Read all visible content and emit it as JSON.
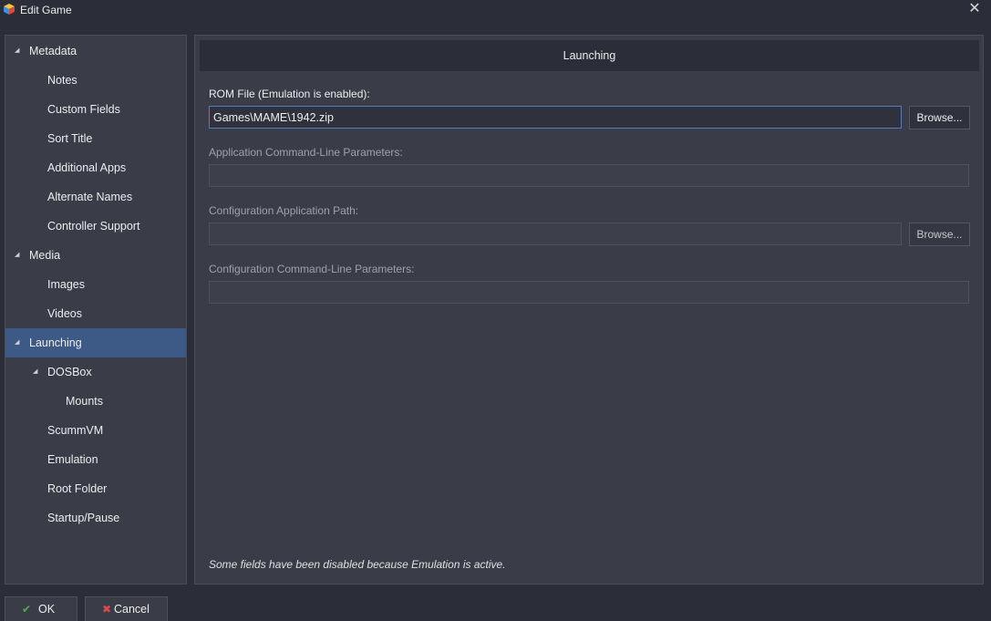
{
  "window": {
    "title": "Edit Game",
    "close_icon": "close-icon",
    "app_icon": "launchbox-cube-icon"
  },
  "sidebar": {
    "items": [
      {
        "label": "Metadata",
        "level": 0,
        "expanded": true
      },
      {
        "label": "Notes",
        "level": 1
      },
      {
        "label": "Custom Fields",
        "level": 1
      },
      {
        "label": "Sort Title",
        "level": 1
      },
      {
        "label": "Additional Apps",
        "level": 1
      },
      {
        "label": "Alternate Names",
        "level": 1
      },
      {
        "label": "Controller Support",
        "level": 1
      },
      {
        "label": "Media",
        "level": 0,
        "expanded": true
      },
      {
        "label": "Images",
        "level": 1
      },
      {
        "label": "Videos",
        "level": 1
      },
      {
        "label": "Launching",
        "level": 0,
        "expanded": true,
        "selected": true
      },
      {
        "label": "DOSBox",
        "level": 1,
        "expanded": true
      },
      {
        "label": "Mounts",
        "level": 2
      },
      {
        "label": "ScummVM",
        "level": 1
      },
      {
        "label": "Emulation",
        "level": 1
      },
      {
        "label": "Root Folder",
        "level": 1
      },
      {
        "label": "Startup/Pause",
        "level": 1
      }
    ]
  },
  "main": {
    "header": "Launching",
    "rom_file": {
      "label": "ROM File (Emulation is enabled):",
      "value": "Games\\MAME\\1942.zip",
      "browse_label": "Browse..."
    },
    "app_params": {
      "label": "Application Command-Line Parameters:",
      "value": ""
    },
    "config_path": {
      "label": "Configuration Application Path:",
      "value": "",
      "browse_label": "Browse..."
    },
    "config_params": {
      "label": "Configuration Command-Line Parameters:",
      "value": ""
    },
    "footnote": "Some fields have been disabled because Emulation is active."
  },
  "footer": {
    "ok_label": "OK",
    "cancel_label": "Cancel"
  },
  "colors": {
    "background": "#2b2d38",
    "panel": "#3a3c48",
    "selected": "#3d5a87",
    "ok_check": "#4caf50",
    "cancel_x": "#e04848"
  }
}
